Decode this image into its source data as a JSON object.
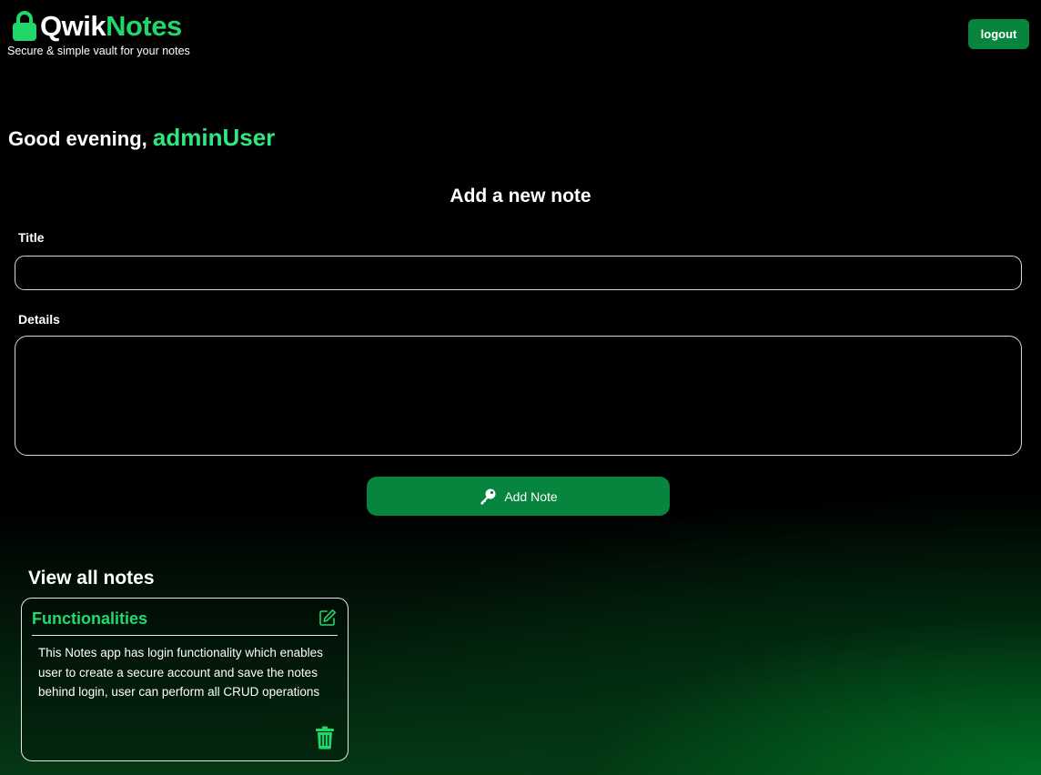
{
  "header": {
    "brand_part1": "Qwik",
    "brand_part2": "Notes",
    "tagline": "Secure & simple vault for your notes",
    "logout_label": "logout",
    "lock_icon": "lock-icon"
  },
  "greeting": {
    "prefix": "Good evening,",
    "username": "adminUser"
  },
  "form": {
    "heading": "Add a new note",
    "title_label": "Title",
    "title_value": "",
    "details_label": "Details",
    "details_value": "",
    "submit_label": "Add Note",
    "submit_icon": "key-icon"
  },
  "notes": {
    "heading": "View all notes",
    "items": [
      {
        "title": "Functionalities",
        "body": "This Notes app has login functionality which enables user to create a secure account and save the notes behind login, user can perform all CRUD operations",
        "edit_icon": "edit-icon",
        "delete_icon": "trash-icon"
      }
    ]
  },
  "colors": {
    "accent_green": "#1fd76a",
    "button_green": "#07843d",
    "background": "#000000"
  }
}
